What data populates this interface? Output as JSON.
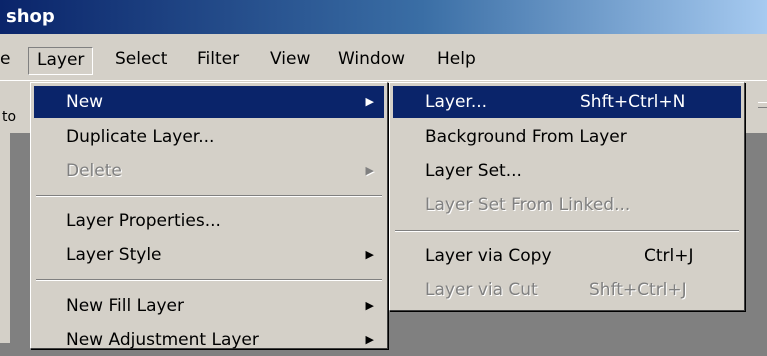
{
  "window": {
    "title": "shop"
  },
  "menubar": {
    "items": [
      {
        "label": "e"
      },
      {
        "label": "Layer"
      },
      {
        "label": "Select"
      },
      {
        "label": "Filter"
      },
      {
        "label": "View"
      },
      {
        "label": "Window"
      },
      {
        "label": "Help"
      }
    ]
  },
  "toolbar": {
    "edge_text": "to"
  },
  "layer_menu": {
    "items": [
      {
        "label": "New",
        "has_submenu": true,
        "highlighted": true
      },
      {
        "label": "Duplicate Layer..."
      },
      {
        "label": "Delete",
        "has_submenu": true,
        "disabled": true
      },
      {
        "label": "Layer Properties..."
      },
      {
        "label": "Layer Style",
        "has_submenu": true
      },
      {
        "label": "New Fill Layer",
        "has_submenu": true
      },
      {
        "label": "New Adjustment Layer",
        "has_submenu": true
      }
    ]
  },
  "new_submenu": {
    "items": [
      {
        "label": "Layer...",
        "shortcut": "Shft+Ctrl+N",
        "highlighted": true
      },
      {
        "label": "Background From Layer"
      },
      {
        "label": "Layer Set..."
      },
      {
        "label": "Layer Set From Linked...",
        "disabled": true
      },
      {
        "label": "Layer via Copy",
        "shortcut": "Ctrl+J"
      },
      {
        "label": "Layer via Cut",
        "shortcut": "Shft+Ctrl+J",
        "disabled": true
      }
    ]
  },
  "icons": {
    "submenu_arrow": "▶"
  },
  "colors": {
    "highlight": "#0a246a",
    "menu_bg": "#d4d0c8",
    "disabled_text": "#808080"
  }
}
